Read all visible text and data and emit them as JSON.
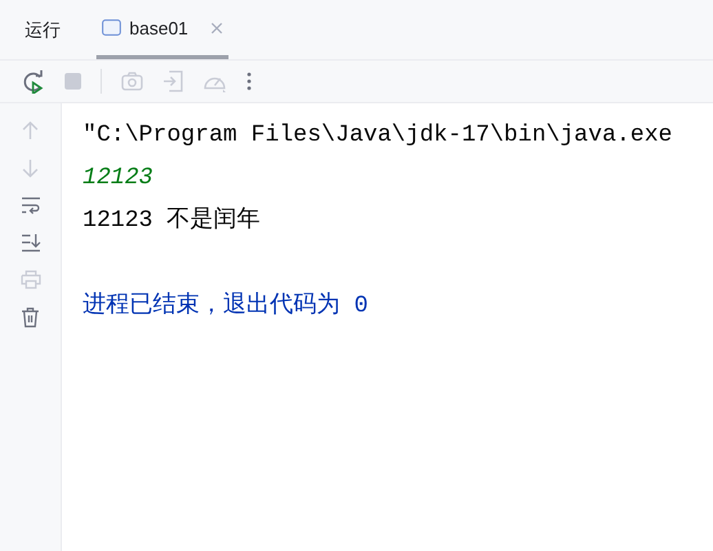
{
  "header": {
    "title": "运行",
    "tabs": [
      {
        "label": "base01",
        "selected": true
      }
    ]
  },
  "console": {
    "lines": [
      {
        "kind": "command",
        "text": "\"C:\\Program Files\\Java\\jdk-17\\bin\\java.exe"
      },
      {
        "kind": "input",
        "text": "12123"
      },
      {
        "kind": "output",
        "text": "12123 不是闰年"
      },
      {
        "kind": "blank"
      },
      {
        "kind": "exit",
        "text": "进程已结束，退出代码为 0"
      }
    ]
  }
}
